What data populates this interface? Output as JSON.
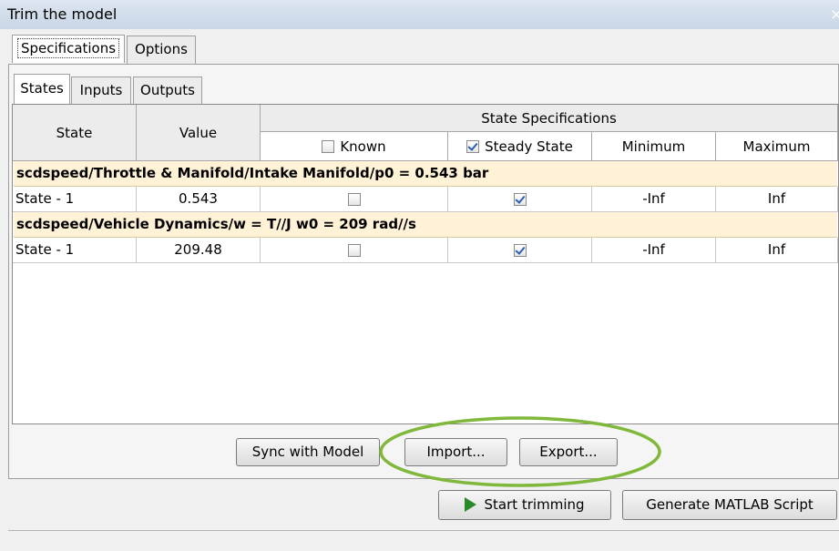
{
  "window": {
    "title": "Trim the model",
    "close_glyph": "×"
  },
  "main_tabs": [
    {
      "label": "Specifications",
      "active": true
    },
    {
      "label": "Options",
      "active": false
    }
  ],
  "sub_tabs": [
    {
      "label": "States",
      "active": true
    },
    {
      "label": "Inputs",
      "active": false
    },
    {
      "label": "Outputs",
      "active": false
    }
  ],
  "table": {
    "headers": {
      "state": "State",
      "value": "Value",
      "specifications": "State Specifications",
      "known": "Known",
      "steady_state": "Steady State",
      "minimum": "Minimum",
      "maximum": "Maximum"
    },
    "header_checkboxes": {
      "known": false,
      "steady_state": true
    },
    "groups": [
      {
        "title": "scdspeed/Throttle & Manifold/Intake Manifold/p0 = 0.543 bar",
        "rows": [
          {
            "state": "State - 1",
            "value": "0.543",
            "known": false,
            "steady_state": true,
            "minimum": "-Inf",
            "maximum": "Inf"
          }
        ]
      },
      {
        "title": "scdspeed/Vehicle Dynamics/w = T//J w0 = 209 rad//s",
        "rows": [
          {
            "state": "State - 1",
            "value": "209.48",
            "known": false,
            "steady_state": true,
            "minimum": "-Inf",
            "maximum": "Inf"
          }
        ]
      }
    ]
  },
  "buttons": {
    "sync": "Sync with Model",
    "import": "Import...",
    "export": "Export...",
    "start": "Start trimming",
    "generate": "Generate MATLAB Script"
  },
  "colors": {
    "group_row": "#fff2d6",
    "highlight": "#7fb83a",
    "start_icon": "#2a8a2a"
  },
  "icons": {
    "start": "play-icon",
    "close": "close-icon"
  }
}
